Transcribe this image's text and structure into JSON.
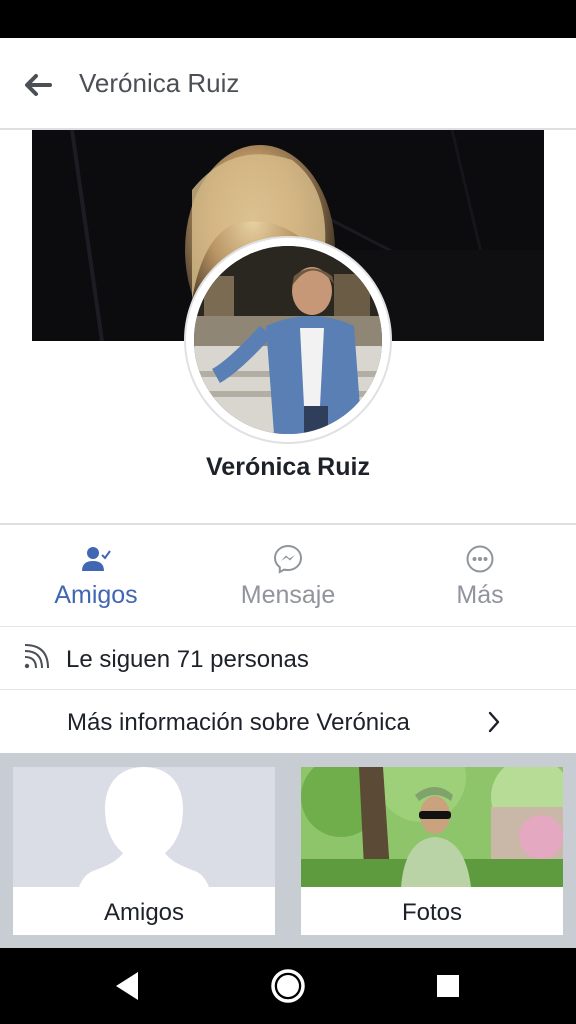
{
  "header": {
    "title": "Verónica Ruiz"
  },
  "profile": {
    "name": "Verónica Ruiz"
  },
  "actions": [
    {
      "label": "Amigos",
      "icon": "friends-check-icon",
      "active": true
    },
    {
      "label": "Mensaje",
      "icon": "messenger-icon",
      "active": false
    },
    {
      "label": "Más",
      "icon": "more-icon",
      "active": false
    }
  ],
  "followers": {
    "text": "Le siguen 71 personas",
    "icon": "rss-icon"
  },
  "info": {
    "text": "Más información sobre Verónica",
    "icon": "chevron-right-icon"
  },
  "tiles": [
    {
      "label": "Amigos"
    },
    {
      "label": "Fotos"
    }
  ],
  "colors": {
    "accent": "#4267b2",
    "muted": "#90949c",
    "divider": "#dddfe2",
    "grid_bg": "#c8ccd3"
  }
}
